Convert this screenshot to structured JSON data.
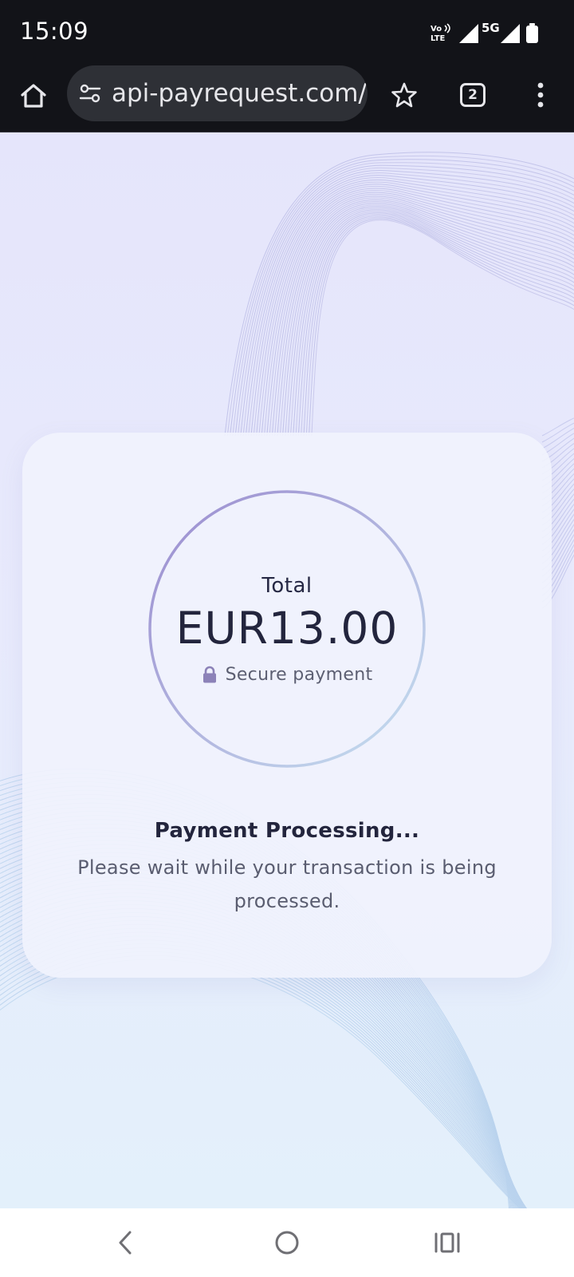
{
  "status_bar": {
    "time": "15:09",
    "volte_label": "Vo LTE",
    "network_label": "5G"
  },
  "browser": {
    "url": "api-payrequest.com/",
    "tab_count": "2"
  },
  "payment": {
    "total_label": "Total",
    "amount": "EUR13.00",
    "secure_label": "Secure payment",
    "status_title": "Payment Processing...",
    "status_description": "Please wait while your transaction is being processed."
  },
  "colors": {
    "status_bar_bg": "#121318",
    "page_bg_top": "#e5e5fb",
    "page_bg_bottom": "#e3f0fb",
    "ring_start": "#9d8fd0",
    "ring_end": "#c4def0",
    "text_primary": "#23253d"
  },
  "icons": {
    "home": "home-icon",
    "site_settings": "tune-icon",
    "bookmark": "star-icon",
    "tabs": "tabs-icon",
    "menu": "more-vert-icon",
    "lock": "lock-icon",
    "back": "back-icon",
    "nav_home": "home-circle-icon",
    "recents": "recents-icon"
  }
}
